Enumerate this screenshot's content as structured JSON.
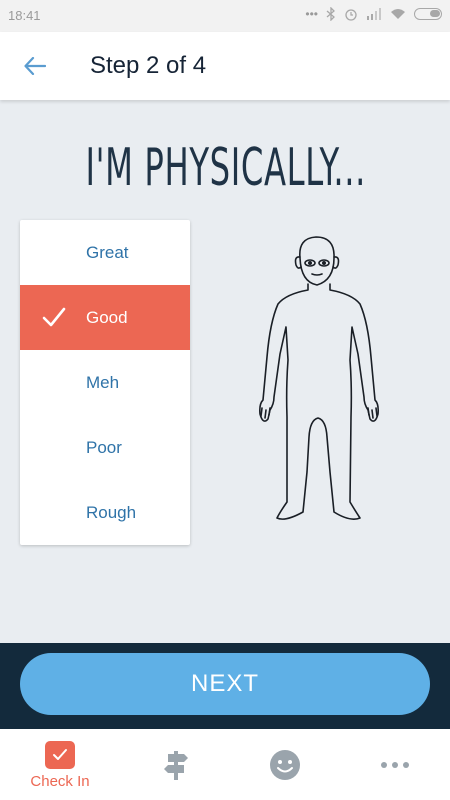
{
  "status_bar": {
    "time": "18:41"
  },
  "header": {
    "title": "Step 2 of 4",
    "back_icon": "arrow-left-icon"
  },
  "headline": "I'M PHYSICALLY...",
  "options": [
    {
      "label": "Great",
      "selected": false
    },
    {
      "label": "Good",
      "selected": true
    },
    {
      "label": "Meh",
      "selected": false
    },
    {
      "label": "Poor",
      "selected": false
    },
    {
      "label": "Rough",
      "selected": false
    }
  ],
  "next_button": {
    "label": "NEXT"
  },
  "bottom_nav": {
    "items": [
      {
        "label": "Check In",
        "icon": "checkbox-icon",
        "active": true
      },
      {
        "label": "",
        "icon": "signpost-icon",
        "active": false
      },
      {
        "label": "",
        "icon": "smiley-icon",
        "active": false
      },
      {
        "label": "",
        "icon": "more-dots-icon",
        "active": false
      }
    ]
  },
  "colors": {
    "accent": "#ec6753",
    "primary_button": "#5fb0e6",
    "footer_bg": "#132a3c",
    "page_bg": "#e9edf1",
    "option_text": "#2f73a8",
    "title_text": "#162436"
  }
}
